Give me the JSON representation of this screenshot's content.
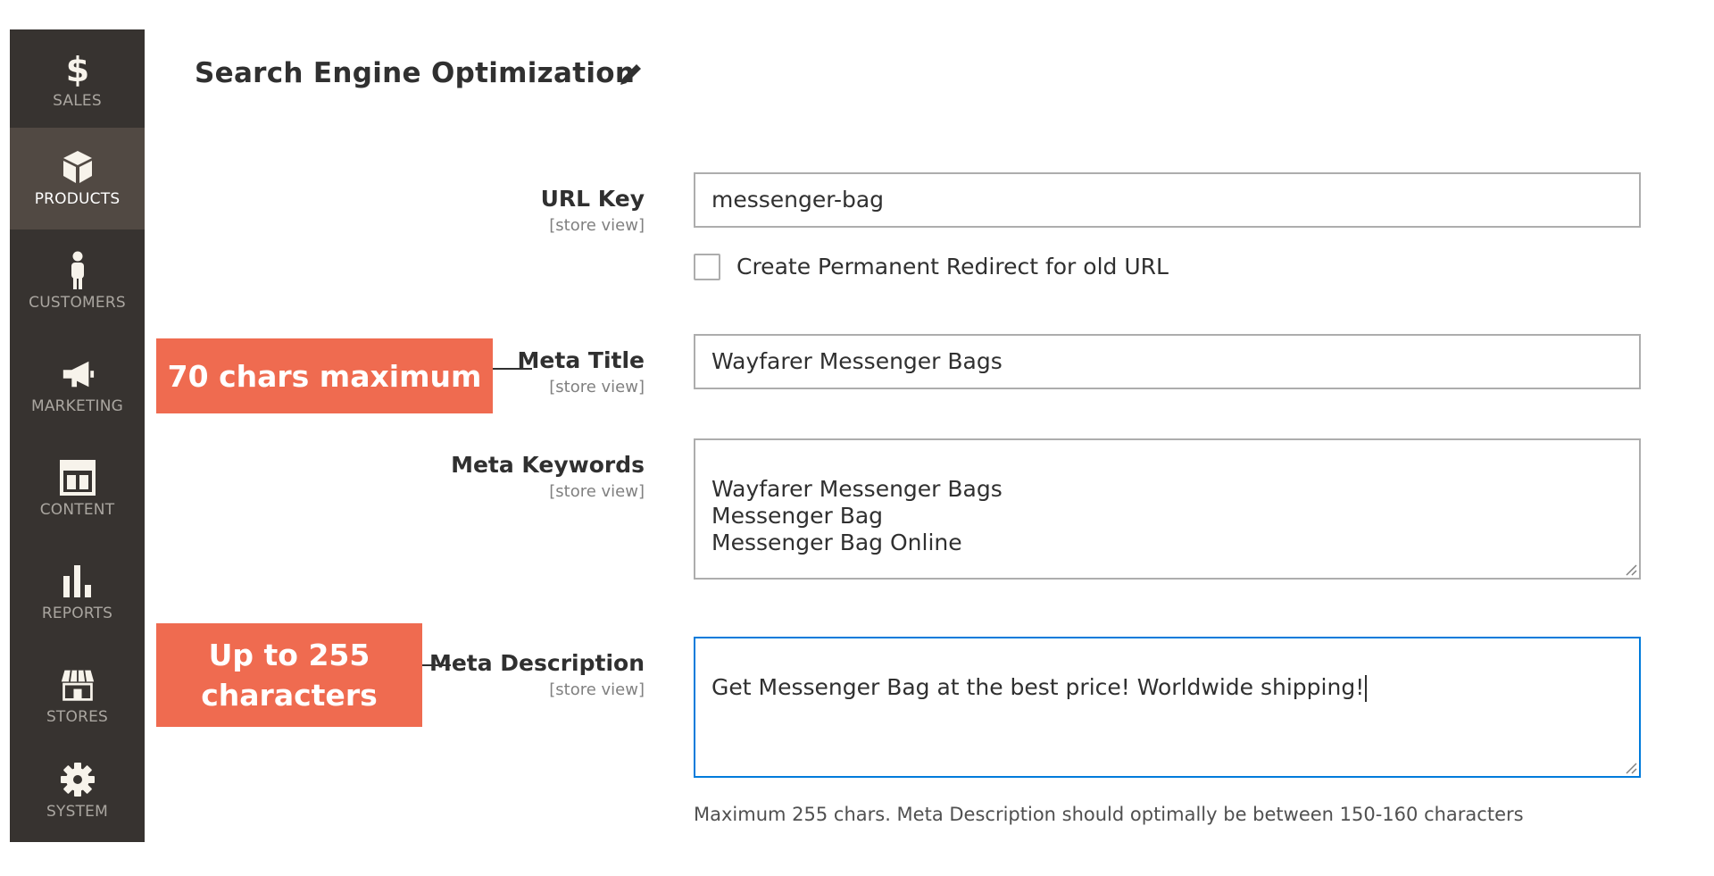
{
  "sidebar": {
    "items": [
      {
        "label": "SALES",
        "icon": "dollar-icon"
      },
      {
        "label": "PRODUCTS",
        "icon": "box-icon",
        "active": true
      },
      {
        "label": "CUSTOMERS",
        "icon": "person-icon"
      },
      {
        "label": "MARKETING",
        "icon": "megaphone-icon"
      },
      {
        "label": "CONTENT",
        "icon": "layout-icon"
      },
      {
        "label": "REPORTS",
        "icon": "bar-chart-icon"
      },
      {
        "label": "STORES",
        "icon": "storefront-icon"
      },
      {
        "label": "SYSTEM",
        "icon": "gear-icon"
      }
    ]
  },
  "section": {
    "title": "Search Engine Optimization"
  },
  "fields": {
    "url_key": {
      "label": "URL Key",
      "scope": "[store view]",
      "value": "messenger-bag"
    },
    "redirect": {
      "label": "Create Permanent Redirect for old URL",
      "checked": false
    },
    "meta_title": {
      "label": "Meta Title",
      "scope": "[store view]",
      "value": "Wayfarer Messenger Bags"
    },
    "meta_keywords": {
      "label": "Meta Keywords",
      "scope": "[store view]",
      "value": "Wayfarer Messenger Bags\nMessenger Bag\nMessenger Bag Online"
    },
    "meta_description": {
      "label": "Meta Description",
      "scope": "[store view]",
      "value": "Get Messenger Bag at the best price! Worldwide shipping!",
      "note": "Maximum 255 chars. Meta Description should optimally be between 150-160 characters"
    }
  },
  "callouts": {
    "title_limit": "70 chars maximum",
    "description_limit": "Up to 255\ncharacters"
  },
  "colors": {
    "sidebar_bg": "#373330",
    "sidebar_active": "#514943",
    "callout": "#ef6b50",
    "focus_border": "#007bdb"
  }
}
